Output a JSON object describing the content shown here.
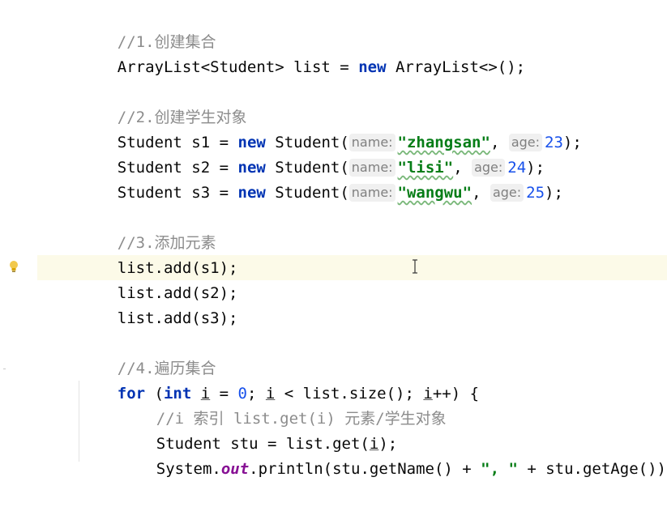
{
  "editor": {
    "lines": {
      "c1": "//1.创建集合",
      "l_list_type": "ArrayList<Student> list = ",
      "l_list_new": "new",
      "l_list_rest": " ArrayList<>();",
      "c2": "//2.创建学生对象",
      "s_prefix": "Student ",
      "s_eq": " = ",
      "new_kw": "new",
      "s_ctor": " Student(",
      "hint_name": "name:",
      "hint_age": "age:",
      "comma": ", ",
      "close": ");",
      "students": [
        {
          "var": "s1",
          "name": "\"zhangsan\"",
          "age": "23"
        },
        {
          "var": "s2",
          "name": "\"lisi\"",
          "age": "24"
        },
        {
          "var": "s3",
          "name": "\"wangwu\"",
          "age": "25"
        }
      ],
      "c3": "//3.添加元素",
      "add1": "list.add(s1);",
      "add2": "list.add(s2);",
      "add3": "list.add(s3);",
      "c4": "//4.遍历集合",
      "for_kw": "for",
      "for_open": " (",
      "int_kw": "int",
      "sp": " ",
      "i": "i",
      "for_init": " = ",
      "zero": "0",
      "semi": "; ",
      "for_cond": " < list.size(); ",
      "for_inc": "++) {",
      "c5": "//i 索引 list.get(i) 元素/学生对象",
      "stu_decl": "Student stu = list.get(",
      "stu_close": ");",
      "sys": "System.",
      "out": "out",
      "println": ".println(stu.getName() + ",
      "sep_str": "\", \"",
      "println_rest": " + stu.getAge());"
    }
  },
  "colors": {
    "keyword": "#0033b3",
    "string": "#067d17",
    "number": "#1750eb",
    "comment": "#8c8c8c",
    "field": "#871094",
    "current_line": "#fcfae8"
  },
  "icons": {
    "gutter": "lightbulb-icon",
    "cursor": "text-cursor-icon"
  }
}
